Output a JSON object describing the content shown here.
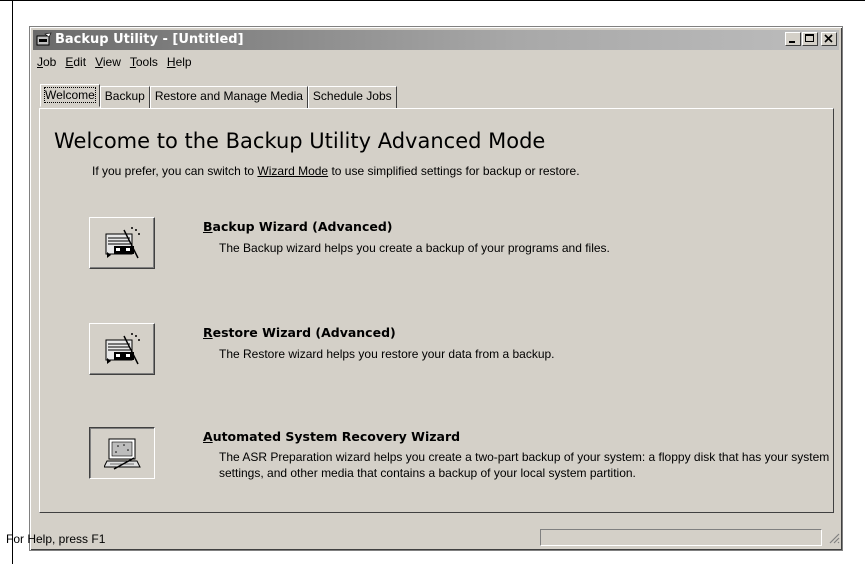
{
  "window": {
    "title": "Backup Utility - [Untitled]",
    "title_icon": "backup-utility-icon"
  },
  "menu": [
    {
      "accel": "J",
      "rest": "ob"
    },
    {
      "accel": "E",
      "rest": "dit"
    },
    {
      "accel": "V",
      "rest": "iew"
    },
    {
      "accel": "T",
      "rest": "ools"
    },
    {
      "accel": "H",
      "rest": "elp"
    }
  ],
  "tabs": [
    "Welcome",
    "Backup",
    "Restore and Manage Media",
    "Schedule Jobs"
  ],
  "active_tab": "Welcome",
  "welcome": {
    "heading": "Welcome to the Backup Utility Advanced Mode",
    "intro_before": "If you prefer, you can switch to ",
    "intro_link": "Wizard Mode",
    "intro_after": " to use simplified settings for backup or restore."
  },
  "wizards": [
    {
      "accel": "B",
      "title_rest": "ackup Wizard (Advanced)",
      "desc": "The Backup wizard helps you create a backup of your programs and files.",
      "icon": "backup-wizard-icon"
    },
    {
      "accel": "R",
      "title_rest": "estore Wizard (Advanced)",
      "desc": "The Restore wizard helps you restore your data from a backup.",
      "icon": "restore-wizard-icon"
    },
    {
      "accel": "A",
      "title_rest": "utomated System Recovery Wizard",
      "desc": "The ASR Preparation wizard helps you create a two-part backup of your system: a floppy disk that has your system settings, and other media that contains a backup of your local system partition.",
      "icon": "asr-wizard-icon"
    }
  ],
  "status": {
    "text": "For Help, press F1"
  },
  "colors": {
    "face": "#d4d0c8",
    "title_bar": "#6a6a6a",
    "title_text": "#ffffff"
  }
}
